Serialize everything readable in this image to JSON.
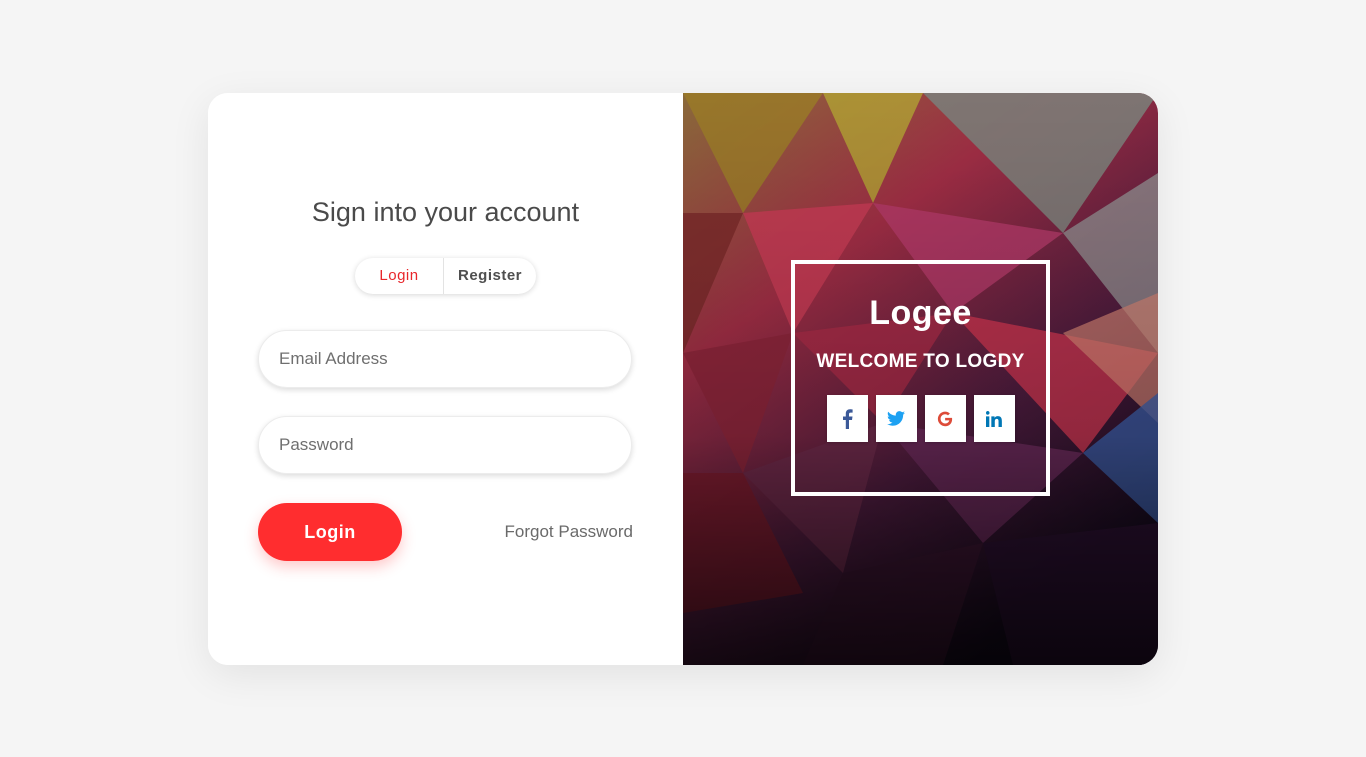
{
  "login_panel": {
    "title": "Sign into your account",
    "tabs": [
      {
        "label": "Login",
        "active": true
      },
      {
        "label": "Register",
        "active": false
      }
    ],
    "email_placeholder": "Email Address",
    "password_placeholder": "Password",
    "login_button": "Login",
    "forgot_password": "Forgot Password"
  },
  "welcome_panel": {
    "brand": "Logee",
    "welcome_text": "WELCOME TO LOGDY",
    "social_icons": [
      {
        "name": "facebook-icon",
        "glyph": "f"
      },
      {
        "name": "twitter-icon",
        "glyph": "🐦"
      },
      {
        "name": "google-icon",
        "glyph": "G"
      },
      {
        "name": "linkedin-icon",
        "glyph": "in"
      }
    ]
  },
  "colors": {
    "accent": "#ff2d2f",
    "active_tab": "#e8262b",
    "page_bg": "#f5f5f5"
  }
}
